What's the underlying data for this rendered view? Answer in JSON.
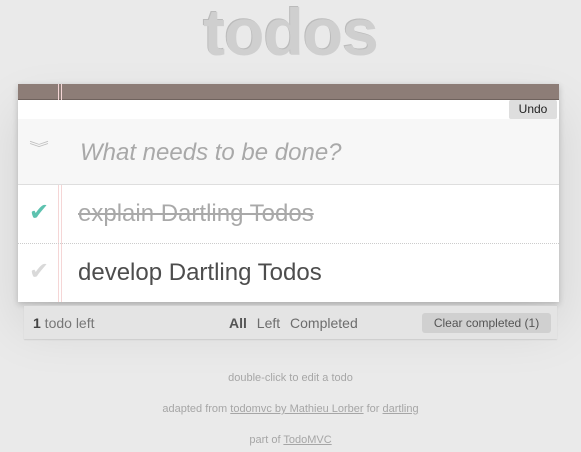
{
  "header": {
    "title": "todos"
  },
  "toolbar": {
    "undo_label": "Undo"
  },
  "new_todo": {
    "placeholder": "What needs to be done?",
    "value": ""
  },
  "todos": [
    {
      "label": "explain Dartling Todos",
      "completed": true
    },
    {
      "label": "develop Dartling Todos",
      "completed": false
    }
  ],
  "footer": {
    "count_number": "1",
    "count_text": " todo left",
    "filters": [
      "All",
      "Left",
      "Completed"
    ],
    "selected_filter": "All",
    "clear_label": "Clear completed (1)"
  },
  "info": {
    "line1": "double-click to edit a todo",
    "line2_prefix": "adapted from ",
    "line2_link1": "todomvc by Mathieu Lorber",
    "line2_mid": " for ",
    "line2_link2": "dartling",
    "line3_prefix": "part of ",
    "line3_link": "TodoMVC"
  },
  "icons": {
    "toggle_all": "chevron-double-down-icon",
    "checked": "checkmark-icon",
    "unchecked": "checkmark-icon"
  },
  "colors": {
    "topbar": "#8d7d77",
    "check_done": "#5dc2af",
    "check_undone": "#d9d9d9"
  }
}
